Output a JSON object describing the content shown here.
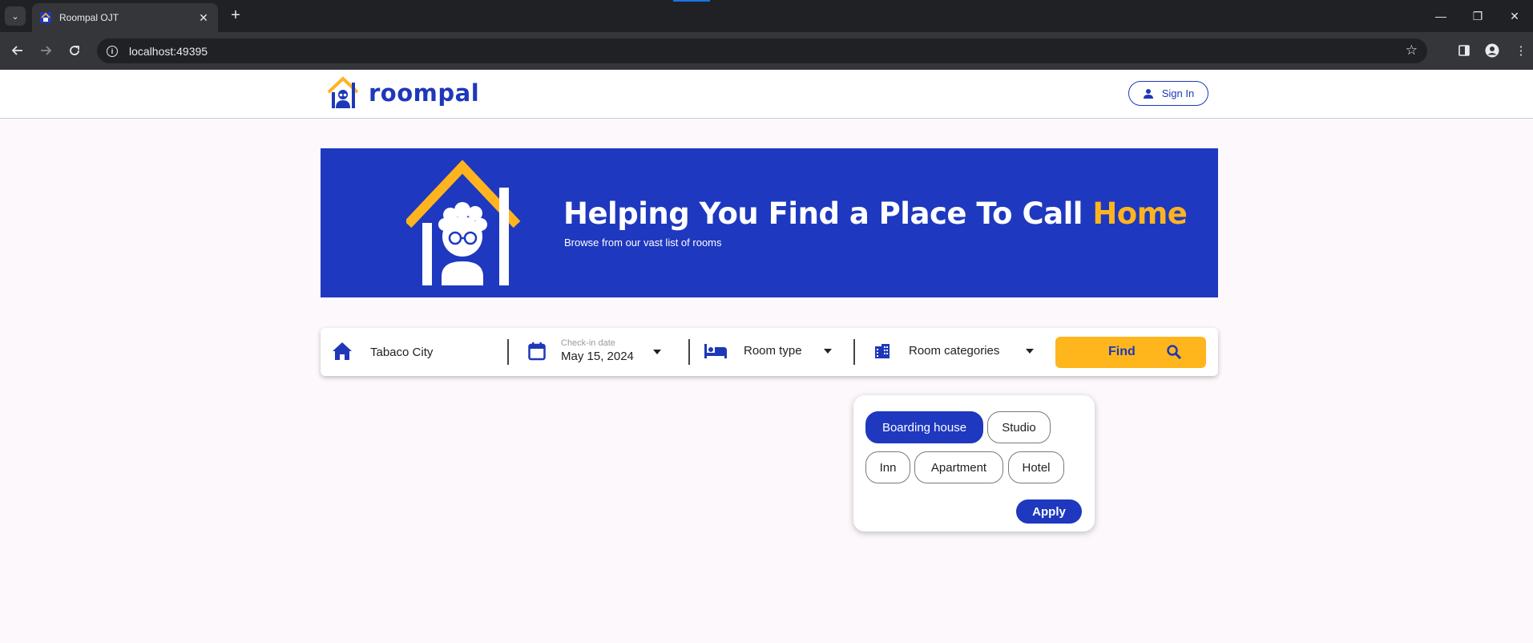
{
  "browser": {
    "tab_title": "Roompal OJT",
    "url": "localhost:49395"
  },
  "header": {
    "logo_text": "roompal",
    "signin_label": "Sign In"
  },
  "hero": {
    "heading_main": "Helping You Find a Place To Call ",
    "heading_accent": "Home",
    "subheading": "Browse from our vast list of rooms"
  },
  "search": {
    "location_value": "Tabaco City",
    "checkin_label": "Check-in date",
    "checkin_value": "May 15, 2024",
    "room_type_label": "Room type",
    "room_categories_label": "Room categories",
    "find_label": "Find"
  },
  "category_popup": {
    "options": [
      {
        "label": "Boarding house",
        "selected": true
      },
      {
        "label": "Studio",
        "selected": false
      },
      {
        "label": "Inn",
        "selected": false
      },
      {
        "label": "Apartment",
        "selected": false
      },
      {
        "label": "Hotel",
        "selected": false
      }
    ],
    "apply_label": "Apply"
  },
  "colors": {
    "brand_blue": "#1e38bf",
    "accent_yellow": "#ffb41f"
  }
}
